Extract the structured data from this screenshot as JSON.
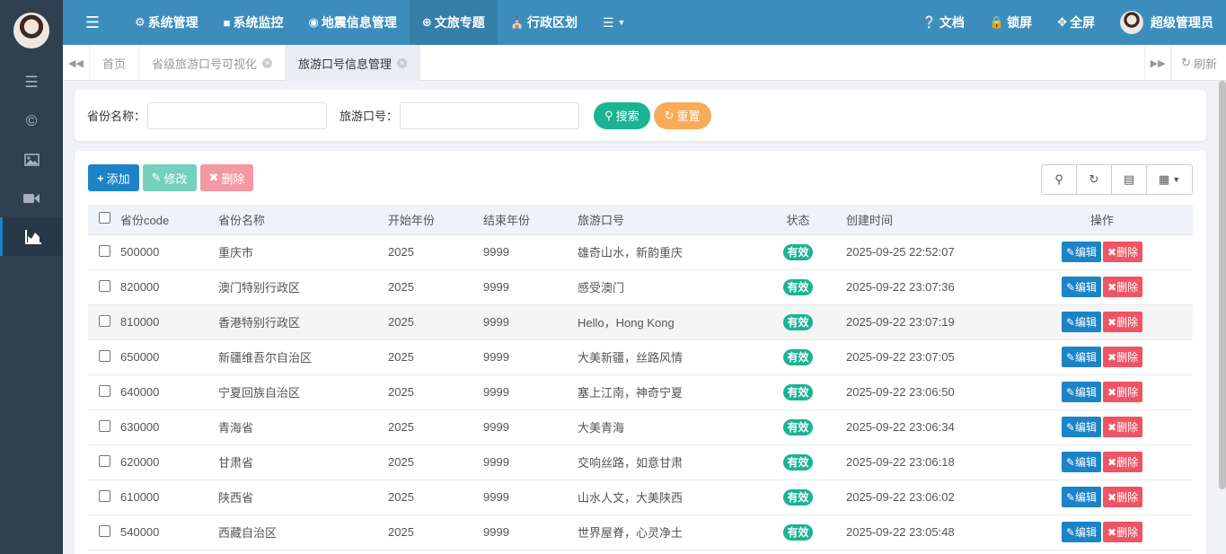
{
  "topbar": {
    "nav": [
      {
        "label": "系统管理",
        "icon": "gear-icon"
      },
      {
        "label": "系统监控",
        "icon": "video-icon"
      },
      {
        "label": "地震信息管理",
        "icon": "map-pin-icon"
      },
      {
        "label": "文旅专题",
        "icon": "globe-icon"
      },
      {
        "label": "行政区划",
        "icon": "bank-icon"
      }
    ],
    "right": {
      "docs": "文档",
      "lock": "锁屏",
      "fullscreen": "全屏",
      "user": "超级管理员"
    }
  },
  "tabs": {
    "items": [
      "首页",
      "省级旅游口号可视化",
      "旅游口号信息管理"
    ],
    "refresh": "刷新"
  },
  "search": {
    "province_label": "省份名称：",
    "slogan_label": "旅游口号：",
    "province_value": "",
    "slogan_value": "",
    "search_btn": "搜索",
    "reset_btn": "重置"
  },
  "toolbar": {
    "add": "添加",
    "edit": "修改",
    "delete": "删除"
  },
  "table": {
    "headers": [
      "省份code",
      "省份名称",
      "开始年份",
      "结束年份",
      "旅游口号",
      "状态",
      "创建时间",
      "操作"
    ],
    "rows": [
      {
        "code": "500000",
        "name": "重庆市",
        "start": "2025",
        "end": "9999",
        "slogan": "雄奇山水，新韵重庆",
        "status": "有效",
        "created": "2025-09-25 22:52:07"
      },
      {
        "code": "820000",
        "name": "澳门特别行政区",
        "start": "2025",
        "end": "9999",
        "slogan": "感受澳门",
        "status": "有效",
        "created": "2025-09-22 23:07:36"
      },
      {
        "code": "810000",
        "name": "香港特别行政区",
        "start": "2025",
        "end": "9999",
        "slogan": "Hello，Hong Kong",
        "status": "有效",
        "created": "2025-09-22 23:07:19"
      },
      {
        "code": "650000",
        "name": "新疆维吾尔自治区",
        "start": "2025",
        "end": "9999",
        "slogan": "大美新疆，丝路风情",
        "status": "有效",
        "created": "2025-09-22 23:07:05"
      },
      {
        "code": "640000",
        "name": "宁夏回族自治区",
        "start": "2025",
        "end": "9999",
        "slogan": "塞上江南，神奇宁夏",
        "status": "有效",
        "created": "2025-09-22 23:06:50"
      },
      {
        "code": "630000",
        "name": "青海省",
        "start": "2025",
        "end": "9999",
        "slogan": "大美青海",
        "status": "有效",
        "created": "2025-09-22 23:06:34"
      },
      {
        "code": "620000",
        "name": "甘肃省",
        "start": "2025",
        "end": "9999",
        "slogan": "交响丝路，如意甘肃",
        "status": "有效",
        "created": "2025-09-22 23:06:18"
      },
      {
        "code": "610000",
        "name": "陕西省",
        "start": "2025",
        "end": "9999",
        "slogan": "山水人文，大美陕西",
        "status": "有效",
        "created": "2025-09-22 23:06:02"
      },
      {
        "code": "540000",
        "name": "西藏自治区",
        "start": "2025",
        "end": "9999",
        "slogan": "世界屋脊，心灵净土",
        "status": "有效",
        "created": "2025-09-22 23:05:48"
      }
    ],
    "op_edit": "编辑",
    "op_delete": "删除"
  },
  "colors": {
    "topbar": "#3c8dbc",
    "sidebar": "#2f4050",
    "primary": "#1c84c6",
    "success": "#1ab394",
    "danger": "#ed5565",
    "warning": "#f8ac59"
  }
}
